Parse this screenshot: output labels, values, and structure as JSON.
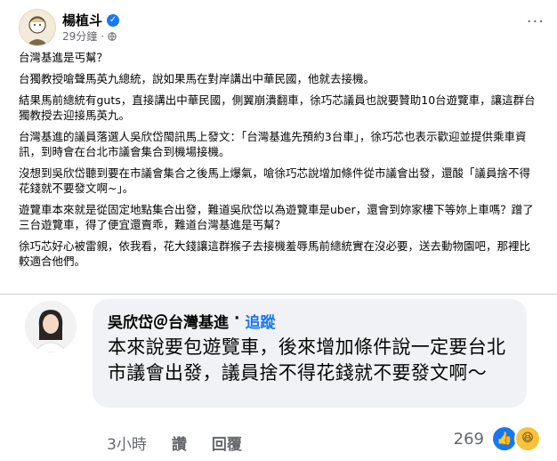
{
  "post": {
    "author": "楊植斗",
    "time": "29分鐘",
    "paragraphs": [
      "台灣基進是丐幫？",
      "台獨教授嗆聲馬英九總統，說如果馬在對岸講出中華民國，他就去接機。",
      "結果馬前總統有guts，直接講出中華民國，側翼崩潰翻車，徐巧芯議員也說要贊助10台遊覽車，讓這群台獨教授去迎接馬英九。",
      "台灣基進的議員落選人吳欣岱閩訊馬上發文：「台灣基進先預約3台車」，徐巧芯也表示歡迎並提供乘車資訊，到時會在台北市議會集合到機場接機。",
      "沒想到吳欣岱聽到要在市議會集合之後馬上爆氣，嗆徐巧芯說增加條件從市議會出發，還酸「議員捨不得花錢就不要發文啊~」。",
      "遊覽車本來就是從固定地點集合出發，難道吳欣岱以為遊覽車是uber，還會到妳家樓下等妳上車嗎？蹭了三台遊覽車，得了便宜還賣乖，難道台灣基進是丐幫？",
      "徐巧芯好心被雷親，依我看，花大錢讓這群猴子去接機羞辱馬前總統實在沒必要，送去動物園吧，那裡比較適合他們。"
    ]
  },
  "comment": {
    "author": "吳欣岱＠台灣基進",
    "separator": "·",
    "follow_label": "追蹤",
    "text": "本來說要包遊覽車，後來增加條件說一定要台北市議會出發，議員捨不得花錢就不要發文啊～",
    "time": "3小時",
    "like_label": "讚",
    "reply_label": "回覆",
    "reaction_count": "269"
  },
  "colors": {
    "accent": "#1877f2",
    "bubble": "#f0f2f5",
    "muted": "#65676b"
  }
}
